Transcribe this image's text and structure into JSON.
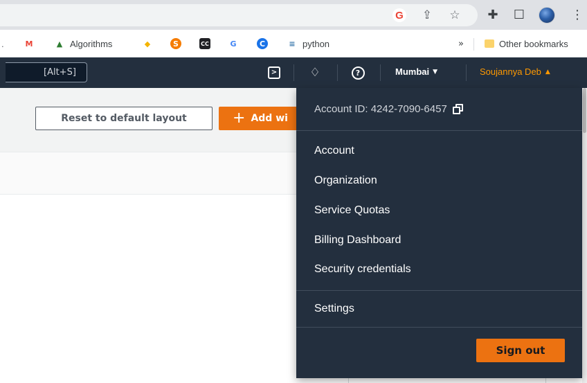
{
  "browser": {
    "toolbar_icons": [
      "google-icon",
      "share-icon",
      "star-icon",
      "extensions-icon",
      "sidepanel-icon",
      "profile-avatar",
      "menu-icon"
    ],
    "bookmarks": [
      {
        "label": "",
        "icon": "gmail-icon",
        "color": "#ea4335",
        "glyph": "M"
      },
      {
        "label": "Algorithms",
        "icon": "algorithms-icon",
        "color": "#2e7d32",
        "glyph": "▲"
      },
      {
        "label": "",
        "icon": "python-icon",
        "color": "#f4b400",
        "glyph": "◆"
      },
      {
        "label": "",
        "icon": "s-logo-icon",
        "color": "#f57c00",
        "glyph": "S"
      },
      {
        "label": "",
        "icon": "cc-icon",
        "color": "#202124",
        "glyph": "CC"
      },
      {
        "label": "",
        "icon": "google-g-icon",
        "color": "#4285f4",
        "glyph": "G"
      },
      {
        "label": "",
        "icon": "c-circle-icon",
        "color": "#1a73e8",
        "glyph": "C"
      },
      {
        "label": "python",
        "icon": "python-site-icon",
        "color": "#3776ab",
        "glyph": "≡"
      }
    ],
    "overflow": "»",
    "other_bookmarks": "Other bookmarks"
  },
  "awsnav": {
    "search_shortcut": "[Alt+S]",
    "region": "Mumbai",
    "user": "Soujannya Deb",
    "user_color": "#ff9900"
  },
  "page": {
    "reset_label": "Reset to default layout",
    "add_label": "Add wi",
    "add_color": "#ec7211"
  },
  "dropdown": {
    "account_id": "Account ID: 4242-7090-6457",
    "items": [
      "Account",
      "Organization",
      "Service Quotas",
      "Billing Dashboard",
      "Security credentials"
    ],
    "settings": "Settings",
    "sign_out": "Sign out",
    "bg_color": "#232f3e"
  }
}
